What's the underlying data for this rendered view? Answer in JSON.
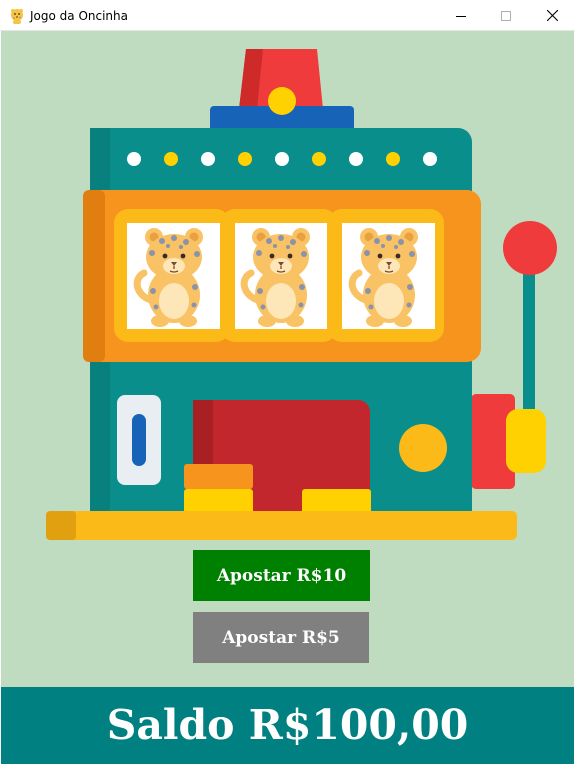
{
  "window": {
    "title": "Jogo da Oncinha",
    "app_icon": "jaguar-icon",
    "controls": [
      "minimize-icon",
      "maximize-icon",
      "close-icon"
    ]
  },
  "slot_machine": {
    "reels": [
      {
        "symbol": "jaguar-cub"
      },
      {
        "symbol": "jaguar-cub"
      },
      {
        "symbol": "jaguar-cub"
      }
    ],
    "lever": "lever-handle"
  },
  "buttons": {
    "bet_10_label": "Apostar R$10",
    "bet_5_label": "Apostar R$5"
  },
  "balance": {
    "text": "Saldo R$100,00"
  },
  "colors": {
    "background": "#c0dcc0",
    "bet_10_button": "#008000",
    "bet_5_button": "#808080",
    "balance_bar": "#008080",
    "machine_body": "#0a8e8b",
    "reel_frame": "#f7941d",
    "beacon": "#ef3b3b"
  }
}
